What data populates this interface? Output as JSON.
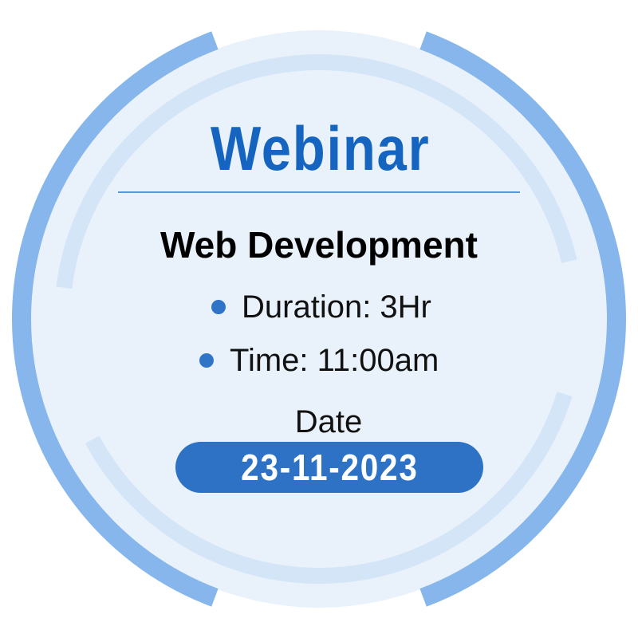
{
  "badge": {
    "title": "Webinar",
    "subtitle": "Web Development",
    "details": [
      "Duration: 3Hr",
      "Time: 11:00am"
    ],
    "date_label": "Date",
    "date_value": "23-11-2023"
  },
  "colors": {
    "outer_ring": "#86b6ec",
    "inner_ring": "#d3e5f7",
    "circle_fill": "#e9f2fb",
    "title": "#1565c0",
    "divider": "#5a97d8",
    "bullet": "#2f74c6",
    "date_pill": "#2e72c6"
  },
  "icons": {
    "bullet": "bullet-dot-icon"
  }
}
